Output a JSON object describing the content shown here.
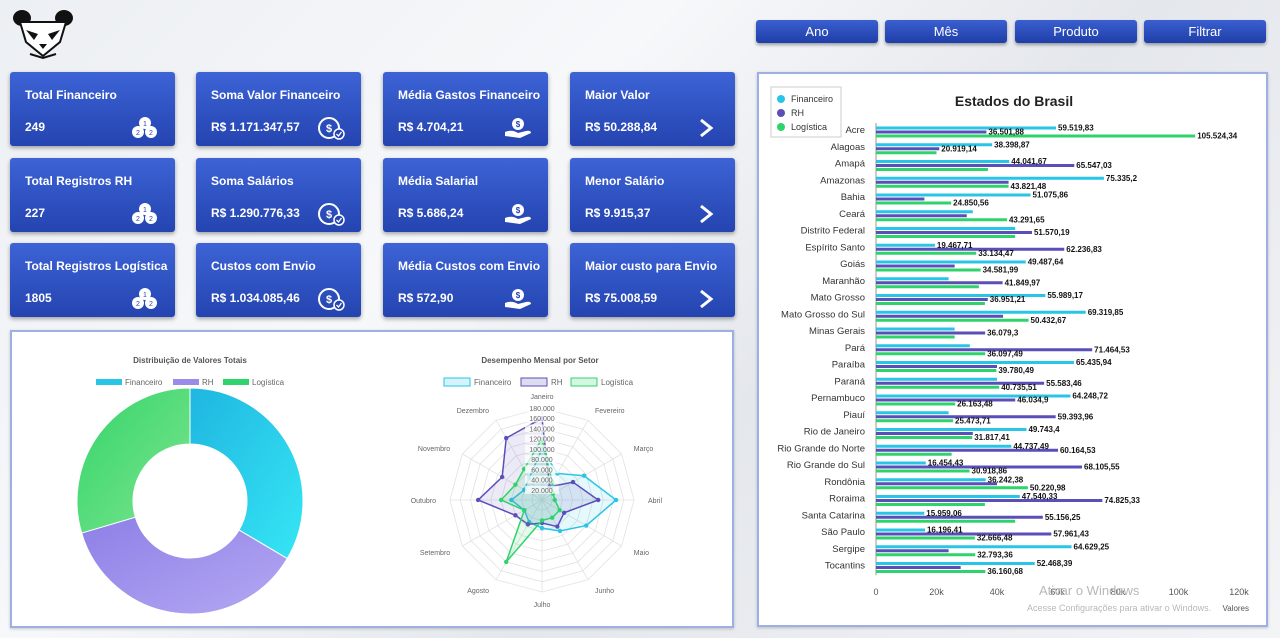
{
  "top_buttons": [
    "Ano",
    "Mês",
    "Produto",
    "Filtrar"
  ],
  "cards": [
    {
      "title": "Total Financeiro",
      "value": "249",
      "icon": "coins-icon"
    },
    {
      "title": "Soma Valor Financeiro",
      "value": "R$ 1.171.347,57",
      "icon": "money-bag-icon"
    },
    {
      "title": "Média Gastos Financeiro",
      "value": "R$ 4.704,21",
      "icon": "hand-money-icon"
    },
    {
      "title": "Maior Valor",
      "value": "R$ 50.288,84",
      "icon": "chevron-right-icon"
    },
    {
      "title": "Total Registros RH",
      "value": "227",
      "icon": "coins-icon"
    },
    {
      "title": "Soma Salários",
      "value": "R$ 1.290.776,33",
      "icon": "money-bag-icon"
    },
    {
      "title": "Média Salarial",
      "value": "R$ 5.686,24",
      "icon": "hand-money-icon"
    },
    {
      "title": "Menor Salário",
      "value": "R$ 9.915,37",
      "icon": "chevron-right-icon"
    },
    {
      "title": "Total Registros Logística",
      "value": "1805",
      "icon": "coins-icon"
    },
    {
      "title": "Custos com Envio",
      "value": "R$ 1.034.085,46",
      "icon": "money-bag-icon"
    },
    {
      "title": "Média Custos com Envio",
      "value": "R$ 572,90",
      "icon": "hand-money-icon"
    },
    {
      "title": "Maior custo para Envio",
      "value": "R$ 75.008,59",
      "icon": "chevron-right-icon"
    }
  ],
  "colors": {
    "financeiro": "#29c5e6",
    "rh": "#5a4fb8",
    "logistica": "#2fd36b",
    "donut_rh": "#9a8ce8"
  },
  "chart_data": [
    {
      "type": "pie",
      "title": "Distribuição de Valores Totais",
      "legend": [
        "Financeiro",
        "RH",
        "Logística"
      ],
      "categories": [
        "Financeiro",
        "RH",
        "Logística"
      ],
      "values": [
        1171347.57,
        1290776.33,
        1034085.46
      ]
    },
    {
      "type": "radar",
      "title": "Desempenho Mensal por Setor",
      "legend": [
        "Financeiro",
        "RH",
        "Logística"
      ],
      "categories": [
        "Janeiro",
        "Fevereiro",
        "Março",
        "Abril",
        "Maio",
        "Junho",
        "Julho",
        "Agosto",
        "Setembro",
        "Outubro",
        "Novembro",
        "Dezembro"
      ],
      "ticks": [
        "20.000",
        "40.000",
        "60.000",
        "80.000",
        "100.000",
        "120.000",
        "140.000",
        "160.000",
        "180.000"
      ],
      "rmax": 180000,
      "series": [
        {
          "name": "Financeiro",
          "values": [
            100000,
            60000,
            95000,
            145000,
            100000,
            70000,
            55000,
            50000,
            40000,
            60000,
            40000,
            50000
          ]
        },
        {
          "name": "RH",
          "values": [
            160000,
            30000,
            70000,
            110000,
            50000,
            60000,
            45000,
            55000,
            60000,
            125000,
            90000,
            140000
          ]
        },
        {
          "name": "Logística",
          "values": [
            120000,
            40000,
            25000,
            25000,
            40000,
            40000,
            40000,
            140000,
            40000,
            80000,
            60000,
            70000
          ]
        }
      ]
    },
    {
      "type": "bar",
      "title": "Estados do Brasil",
      "legend": [
        "Financeiro",
        "RH",
        "Logística"
      ],
      "xlabel": "Valores",
      "xlim": [
        0,
        120000
      ],
      "xticks": [
        "0",
        "20k",
        "40k",
        "60k",
        "80k",
        "100k",
        "120k"
      ],
      "categories": [
        "Acre",
        "Alagoas",
        "Amapá",
        "Amazonas",
        "Bahia",
        "Ceará",
        "Distrito Federal",
        "Espírito Santo",
        "Goiás",
        "Maranhão",
        "Mato Grosso",
        "Mato Grosso do Sul",
        "Minas Gerais",
        "Pará",
        "Paraíba",
        "Paraná",
        "Pernambuco",
        "Piauí",
        "Rio de Janeiro",
        "Rio Grande do Norte",
        "Rio Grande do Sul",
        "Rondônia",
        "Roraima",
        "Santa Catarina",
        "São Paulo",
        "Sergipe",
        "Tocantins"
      ],
      "series": [
        {
          "name": "Financeiro",
          "values": [
            59519.83,
            38398.87,
            44041.67,
            75335.2,
            51075.86,
            32000,
            46000,
            19467.71,
            49487.64,
            24000,
            55989.17,
            69319.85,
            26000,
            31000,
            65435.94,
            40000,
            64248.72,
            24000,
            49743.4,
            44737.49,
            16454.43,
            36242.38,
            47540.33,
            15959.06,
            16196.41,
            64629.25,
            52468.39
          ]
        },
        {
          "name": "RH",
          "values": [
            36501.88,
            20919.14,
            65547.03,
            43821.48,
            16000,
            30000,
            51570.19,
            62236.83,
            26000,
            41849.97,
            36951.21,
            42000,
            36079.3,
            71464.53,
            40000,
            55583.46,
            46034.9,
            59393.96,
            32000,
            60164.53,
            68105.55,
            40000,
            74825.33,
            55156.25,
            57961.43,
            24000,
            28000
          ]
        },
        {
          "name": "Logística",
          "values": [
            105524.34,
            20000,
            37000,
            43821.48,
            24850.56,
            43291.65,
            46000,
            33134.47,
            34581.99,
            34000,
            36000,
            50432.67,
            26000,
            36097.49,
            39780.49,
            40735.51,
            26163.48,
            25473.71,
            31817.41,
            25000,
            30918.86,
            50220.98,
            36000,
            46000,
            32666.48,
            32793.36,
            36160.68
          ]
        }
      ],
      "data_labels": [
        {
          "i": 0,
          "s": 0,
          "text": "59.519,83"
        },
        {
          "i": 0,
          "s": 1,
          "text": "36.501,88"
        },
        {
          "i": 0,
          "s": 2,
          "text": "105.524,34"
        },
        {
          "i": 1,
          "s": 0,
          "text": "38.398,87"
        },
        {
          "i": 1,
          "s": 1,
          "text": "20.919,14"
        },
        {
          "i": 2,
          "s": 0,
          "text": "44.041,67"
        },
        {
          "i": 2,
          "s": 1,
          "text": "65.547,03"
        },
        {
          "i": 3,
          "s": 0,
          "text": "75.335,2"
        },
        {
          "i": 3,
          "s": 2,
          "text": "43.821,48"
        },
        {
          "i": 4,
          "s": 0,
          "text": "51.075,86"
        },
        {
          "i": 4,
          "s": 2,
          "text": "24.850,56"
        },
        {
          "i": 5,
          "s": 2,
          "text": "43.291,65"
        },
        {
          "i": 6,
          "s": 1,
          "text": "51.570,19"
        },
        {
          "i": 7,
          "s": 0,
          "text": "19.467,71"
        },
        {
          "i": 7,
          "s": 1,
          "text": "62.236,83"
        },
        {
          "i": 7,
          "s": 2,
          "text": "33.134,47"
        },
        {
          "i": 8,
          "s": 0,
          "text": "49.487,64"
        },
        {
          "i": 8,
          "s": 2,
          "text": "34.581,99"
        },
        {
          "i": 9,
          "s": 1,
          "text": "41.849,97"
        },
        {
          "i": 10,
          "s": 0,
          "text": "55.989,17"
        },
        {
          "i": 10,
          "s": 1,
          "text": "36.951,21"
        },
        {
          "i": 11,
          "s": 0,
          "text": "69.319,85"
        },
        {
          "i": 11,
          "s": 2,
          "text": "50.432,67"
        },
        {
          "i": 12,
          "s": 1,
          "text": "36.079,3"
        },
        {
          "i": 13,
          "s": 1,
          "text": "71.464,53"
        },
        {
          "i": 13,
          "s": 2,
          "text": "36.097,49"
        },
        {
          "i": 14,
          "s": 0,
          "text": "65.435,94"
        },
        {
          "i": 14,
          "s": 2,
          "text": "39.780,49"
        },
        {
          "i": 15,
          "s": 1,
          "text": "55.583,46"
        },
        {
          "i": 15,
          "s": 2,
          "text": "40.735,51"
        },
        {
          "i": 16,
          "s": 0,
          "text": "64.248,72"
        },
        {
          "i": 16,
          "s": 1,
          "text": "46.034,9"
        },
        {
          "i": 16,
          "s": 2,
          "text": "26.163,48"
        },
        {
          "i": 17,
          "s": 1,
          "text": "59.393,96"
        },
        {
          "i": 17,
          "s": 2,
          "text": "25.473,71"
        },
        {
          "i": 18,
          "s": 0,
          "text": "49.743,4"
        },
        {
          "i": 18,
          "s": 2,
          "text": "31.817,41"
        },
        {
          "i": 19,
          "s": 0,
          "text": "44.737,49"
        },
        {
          "i": 19,
          "s": 1,
          "text": "60.164,53"
        },
        {
          "i": 20,
          "s": 0,
          "text": "16.454,43"
        },
        {
          "i": 20,
          "s": 1,
          "text": "68.105,55"
        },
        {
          "i": 20,
          "s": 2,
          "text": "30.918,86"
        },
        {
          "i": 21,
          "s": 0,
          "text": "36.242,38"
        },
        {
          "i": 21,
          "s": 2,
          "text": "50.220,98"
        },
        {
          "i": 22,
          "s": 0,
          "text": "47.540,33"
        },
        {
          "i": 22,
          "s": 1,
          "text": "74.825,33"
        },
        {
          "i": 23,
          "s": 0,
          "text": "15.959,06"
        },
        {
          "i": 23,
          "s": 1,
          "text": "55.156,25"
        },
        {
          "i": 24,
          "s": 0,
          "text": "16.196,41"
        },
        {
          "i": 24,
          "s": 1,
          "text": "57.961,43"
        },
        {
          "i": 24,
          "s": 2,
          "text": "32.666,48"
        },
        {
          "i": 25,
          "s": 0,
          "text": "64.629,25"
        },
        {
          "i": 25,
          "s": 2,
          "text": "32.793,36"
        },
        {
          "i": 26,
          "s": 0,
          "text": "52.468,39"
        },
        {
          "i": 26,
          "s": 2,
          "text": "36.160,68"
        }
      ]
    }
  ],
  "watermark": {
    "title": "Ativar o Windows",
    "subtitle": "Acesse Configurações para ativar o Windows."
  }
}
